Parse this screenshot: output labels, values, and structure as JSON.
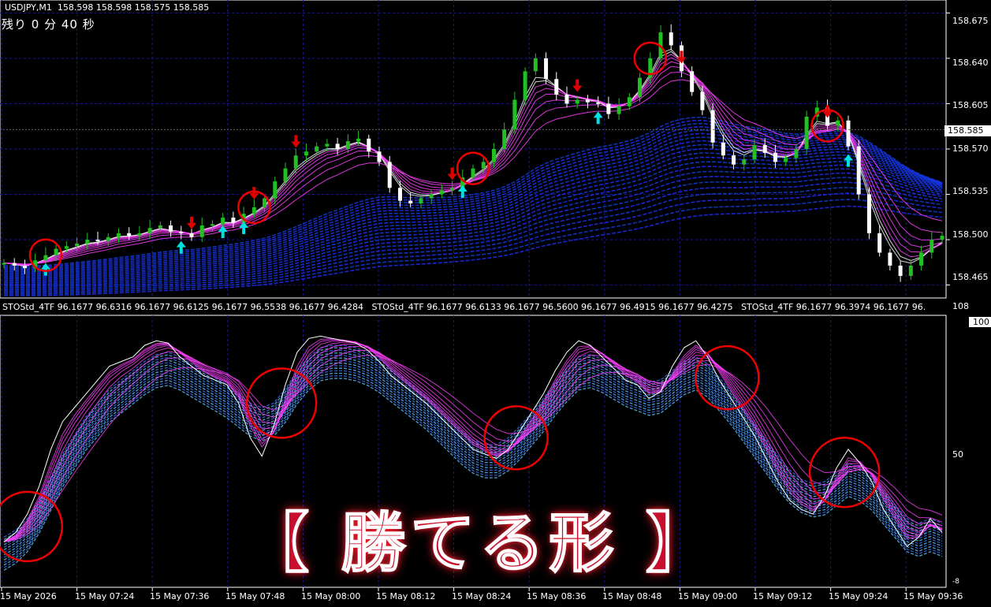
{
  "header": {
    "symbol_line": "USDJPY,M1  158.598 158.598 158.575 158.585",
    "timer": "残り 0 分 40 秒"
  },
  "price_axis": [
    "158.675",
    "158.640",
    "158.605",
    "158.570",
    "158.535",
    "158.500",
    "158.465"
  ],
  "current_price": "158.585",
  "indicator_header": "STOStd_4TF 96.1677 96.6316 96.1677 96.6125 96.1677 96.5538 96.1677 96.4284   STOStd_4TF 96.1677 96.6133 96.1677 96.5600 96.1677 96.4915 96.1677 96.4275   STOStd_4TF 96.1677 96.3974 96.1677 96.",
  "sub_axis": {
    "top": "108",
    "tag100": "100",
    "mid": "50",
    "bottom": "-8"
  },
  "time_axis": [
    "15 May 2026",
    "15 May 07:24",
    "15 May 07:36",
    "15 May 07:48",
    "15 May 08:00",
    "15 May 08:12",
    "15 May 08:24",
    "15 May 08:36",
    "15 May 08:48",
    "15 May 09:00",
    "15 May 09:12",
    "15 May 09:24",
    "15 May 09:36"
  ],
  "banner": "【 勝てる形 】",
  "colors": {
    "bull": "#22c022",
    "bear": "#ffffff",
    "buy_arrow": "#00e0e0",
    "sell_arrow": "#e00000",
    "ribbon_fast": "#ff30ff",
    "ribbon_slow": "#1030ff",
    "sto_band": "#3fa0ff",
    "circle": "#e00000"
  },
  "chart_data": {
    "type": "candlestick",
    "symbol": "USDJPY",
    "timeframe": "M1",
    "ylim": [
      158.455,
      158.685
    ],
    "price_path": [
      158.482,
      158.48,
      158.478,
      158.484,
      158.488,
      158.493,
      158.495,
      158.497,
      158.5,
      158.499,
      158.502,
      158.505,
      158.503,
      158.505,
      158.509,
      158.511,
      158.506,
      158.505,
      158.502,
      158.511,
      158.512,
      158.517,
      158.513,
      158.52,
      158.525,
      158.532,
      158.545,
      158.555,
      158.565,
      158.568,
      158.572,
      158.574,
      158.57,
      158.576,
      158.578,
      158.568,
      158.56,
      158.54,
      158.53,
      158.528,
      158.532,
      158.535,
      158.538,
      158.54,
      158.548,
      158.555,
      158.56,
      158.57,
      158.585,
      158.608,
      158.63,
      158.64,
      158.624,
      158.612,
      158.605,
      158.608,
      158.606,
      158.605,
      158.597,
      158.603,
      158.61,
      158.625,
      158.64,
      158.66,
      158.65,
      158.63,
      158.614,
      158.6,
      158.575,
      158.565,
      158.558,
      158.562,
      158.573,
      158.567,
      158.56,
      158.563,
      158.57,
      158.595,
      158.602,
      158.588,
      158.592,
      158.572,
      158.535,
      158.505,
      158.49,
      158.48,
      158.472,
      158.48,
      158.49,
      158.5,
      158.503
    ],
    "sto_main": [
      10,
      14,
      22,
      34,
      50,
      62,
      68,
      74,
      80,
      86,
      88,
      90,
      95,
      97,
      96,
      90,
      86,
      82,
      80,
      78,
      70,
      55,
      47,
      60,
      78,
      92,
      98,
      99,
      98,
      97,
      96,
      93,
      88,
      82,
      78,
      74,
      70,
      65,
      60,
      55,
      50,
      48,
      46,
      50,
      58,
      66,
      74,
      84,
      92,
      97,
      95,
      90,
      85,
      80,
      78,
      72,
      75,
      86,
      94,
      97,
      90,
      80,
      72,
      64,
      56,
      46,
      36,
      28,
      24,
      22,
      30,
      42,
      50,
      44,
      36,
      24,
      16,
      8,
      12,
      20,
      14
    ],
    "sto_ribbon_center": [
      12,
      15,
      20,
      28,
      38,
      48,
      56,
      64,
      70,
      76,
      80,
      84,
      88,
      91,
      92,
      90,
      87,
      84,
      81,
      78,
      74,
      70,
      68,
      70,
      76,
      84,
      90,
      94,
      95,
      95,
      94,
      92,
      89,
      85,
      81,
      77,
      73,
      68,
      63,
      58,
      54,
      52,
      52,
      55,
      60,
      66,
      72,
      79,
      85,
      90,
      91,
      89,
      86,
      83,
      81,
      79,
      80,
      84,
      88,
      90,
      87,
      81,
      75,
      68,
      61,
      54,
      47,
      41,
      37,
      35,
      36,
      40,
      44,
      42,
      38,
      32,
      26,
      20,
      18,
      20,
      18
    ],
    "signals": [
      {
        "type": "buy",
        "price_index": 4
      },
      {
        "type": "sell",
        "price_index": 18
      },
      {
        "type": "buy",
        "price_index": 17
      },
      {
        "type": "buy",
        "price_index": 21
      },
      {
        "type": "buy",
        "price_index": 23
      },
      {
        "type": "sell",
        "price_index": 24
      },
      {
        "type": "sell",
        "price_index": 28
      },
      {
        "type": "sell",
        "price_index": 43
      },
      {
        "type": "buy",
        "price_index": 44
      },
      {
        "type": "sell",
        "price_index": 55
      },
      {
        "type": "buy",
        "price_index": 57
      },
      {
        "type": "sell",
        "price_index": 65
      },
      {
        "type": "sell",
        "price_index": 79
      },
      {
        "type": "buy",
        "price_index": 81
      }
    ],
    "highlight_price_indices": [
      4,
      24,
      45,
      62,
      79
    ],
    "highlight_sto_indices": [
      2,
      23,
      43,
      61,
      71
    ]
  }
}
